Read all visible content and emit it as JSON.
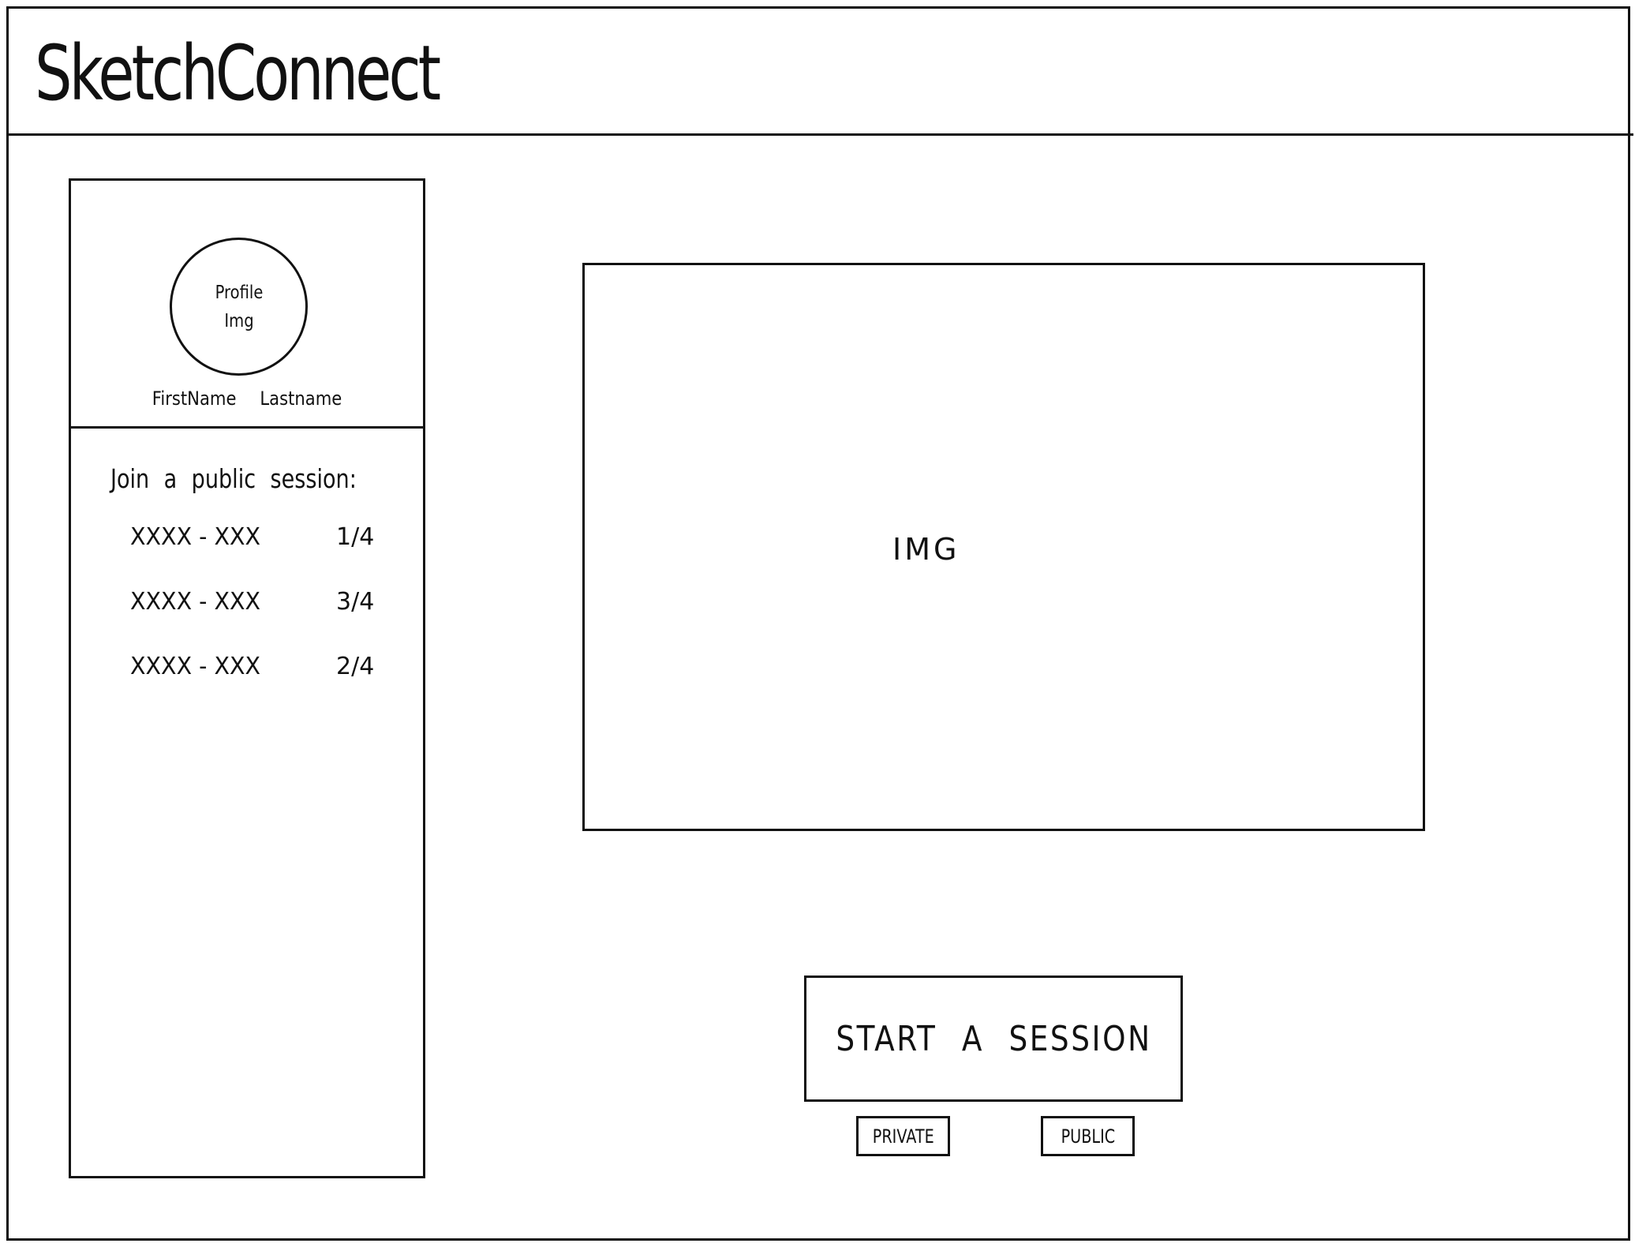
{
  "header": {
    "title": "SketchConnect"
  },
  "sidebar": {
    "profile": {
      "avatar_label": "Profile Img",
      "first_name": "FirstName",
      "last_name": "Lastname"
    },
    "sessions_heading": "Join a public session:",
    "sessions": [
      {
        "code": "XXXX - XXX",
        "occupancy": "1/4"
      },
      {
        "code": "XXXX - XXX",
        "occupancy": "3/4"
      },
      {
        "code": "XXXX - XXX",
        "occupancy": "2/4"
      }
    ]
  },
  "main": {
    "image_label": "IMG",
    "start_button_label": "START A SESSION",
    "private_label": "PRIVATE",
    "public_label": "PUBLIC"
  }
}
